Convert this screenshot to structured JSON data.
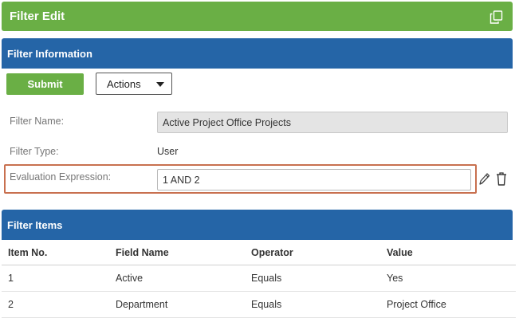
{
  "header": {
    "title": "Filter Edit",
    "copy_icon": "copy-icon"
  },
  "filter_information": {
    "title": "Filter Information",
    "submit_label": "Submit",
    "actions_label": "Actions",
    "fields": {
      "name_label": "Filter Name:",
      "name_value": "Active Project Office Projects",
      "type_label": "Filter Type:",
      "type_value": "User",
      "expression_label": "Evaluation Expression:",
      "expression_value": "1 AND 2"
    },
    "icons": [
      "pencil-icon",
      "trash-icon"
    ]
  },
  "filter_items": {
    "title": "Filter Items",
    "columns": [
      "Item No.",
      "Field Name",
      "Operator",
      "Value"
    ],
    "rows": [
      [
        "1",
        "Active",
        "Equals",
        "Yes"
      ],
      [
        "2",
        "Department",
        "Equals",
        "Project Office"
      ]
    ]
  },
  "colors": {
    "title_bar": "#6aaf45",
    "section_header": "#2565a7",
    "highlight_border": "#c8704f"
  }
}
